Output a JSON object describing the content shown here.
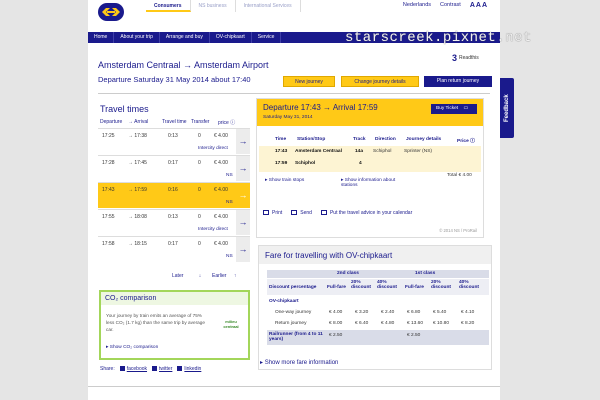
{
  "header": {
    "tabs": [
      {
        "label": "Consumers",
        "active": true
      },
      {
        "label": "NS business",
        "active": false
      },
      {
        "label": "International Services",
        "active": false
      }
    ],
    "utils": {
      "language": "Nederlands",
      "contrast": "Contrast",
      "text_size": "AAA"
    }
  },
  "nav": {
    "items": [
      "Home",
      "About your trip",
      "Arrange and buy",
      "OV-chipkaart",
      "Service"
    ]
  },
  "watermark": "starscreek.pixnet.net",
  "read_this": {
    "num": "3",
    "label": "Readthis"
  },
  "route": {
    "title": "Amsterdam Centraal  →  Amsterdam Airport",
    "departure": "Departure Saturday 31 May 2014 about 17:40"
  },
  "actions": {
    "new_journey": "New journey",
    "change_details": "Change journey details",
    "plan_return": "Plan return journey"
  },
  "travel_times": {
    "title": "Travel times",
    "headers": {
      "departure": "Departure",
      "arrival": "→ Arrival",
      "travel_time": "Travel time",
      "transfer": "Transfer",
      "price": "price ⓘ"
    },
    "rows": [
      {
        "dep": "17:25",
        "arr": "→ 17:38",
        "time": "0:13",
        "transfer": "0",
        "price": "€ 4.00",
        "note": "Intercity direct",
        "selected": false
      },
      {
        "dep": "17:28",
        "arr": "→ 17:45",
        "time": "0:17",
        "transfer": "0",
        "price": "€ 4.00",
        "note": "NS",
        "selected": false
      },
      {
        "dep": "17:43",
        "arr": "→ 17:59",
        "time": "0:16",
        "transfer": "0",
        "price": "€ 4.00",
        "note": "NS",
        "selected": true
      },
      {
        "dep": "17:55",
        "arr": "→ 18:08",
        "time": "0:13",
        "transfer": "0",
        "price": "€ 4.00",
        "note": "Intercity direct",
        "selected": false
      },
      {
        "dep": "17:58",
        "arr": "→ 18:15",
        "time": "0:17",
        "transfer": "0",
        "price": "€ 4.00",
        "note": "NS",
        "selected": false
      }
    ],
    "later": "Later",
    "earlier": "Earlier"
  },
  "co2": {
    "title": "CO₂ comparison",
    "text": "Your journey by train emits an average of 75% less CO₂ (1.7 kg) than the same trip by average car.",
    "logo": "milieu centraal",
    "link": "Show CO₂ comparison"
  },
  "share": {
    "label": "Share:",
    "facebook": "facebook",
    "twitter": "twitter",
    "linkedin": "linkedin"
  },
  "details": {
    "title": "Departure 17:43 → Arrival 17:59",
    "date": "Saturday May 31, 2014",
    "buy_ticket": "Buy Ticket",
    "headers": {
      "time": "Time",
      "station": "Station/Stop",
      "track": "Track",
      "direction": "Direction",
      "journey_details": "Journey details",
      "price": "Price ⓘ"
    },
    "rows": [
      {
        "time": "17:43",
        "station": "Amsterdam Centraal",
        "track": "14a",
        "direction": "Schiphol",
        "details": "Sprinter (NS)"
      },
      {
        "time": "17:59",
        "station": "Schiphol",
        "track": "4",
        "direction": "",
        "details": ""
      }
    ],
    "show_stops": "Show train stops",
    "show_info": "Show information about stations",
    "total": "Total € 4.00",
    "print": "Print",
    "send": "Send",
    "calendar": "Put the travel advice in your calendar",
    "copyright": "© 2014 NS / ProRail"
  },
  "fare": {
    "title": "Fare for travelling with OV-chipkaart",
    "class2": "2nd class",
    "class1": "1st class",
    "cols": [
      "Discount percentage",
      "Full-fare",
      "20% discount",
      "40% discount",
      "Full-fare",
      "20% discount",
      "40% discount"
    ],
    "section": "OV-chipkaart",
    "rows": [
      {
        "label": "One-way journey",
        "values": [
          "€ 4.00",
          "€ 3.20",
          "€ 2.40",
          "€ 6.80",
          "€ 5.40",
          "€ 4.10"
        ]
      },
      {
        "label": "Return journey",
        "values": [
          "€ 8.00",
          "€ 6.40",
          "€ 4.80",
          "€ 13.60",
          "€ 10.80",
          "€ 8.20"
        ]
      }
    ],
    "railrunner": {
      "label": "Railrunner (from 4 to 11 years)",
      "value2": "€ 2.50",
      "value1": "€ 2.50"
    },
    "more_info": "Show more fare information"
  },
  "feedback": "Feedback"
}
